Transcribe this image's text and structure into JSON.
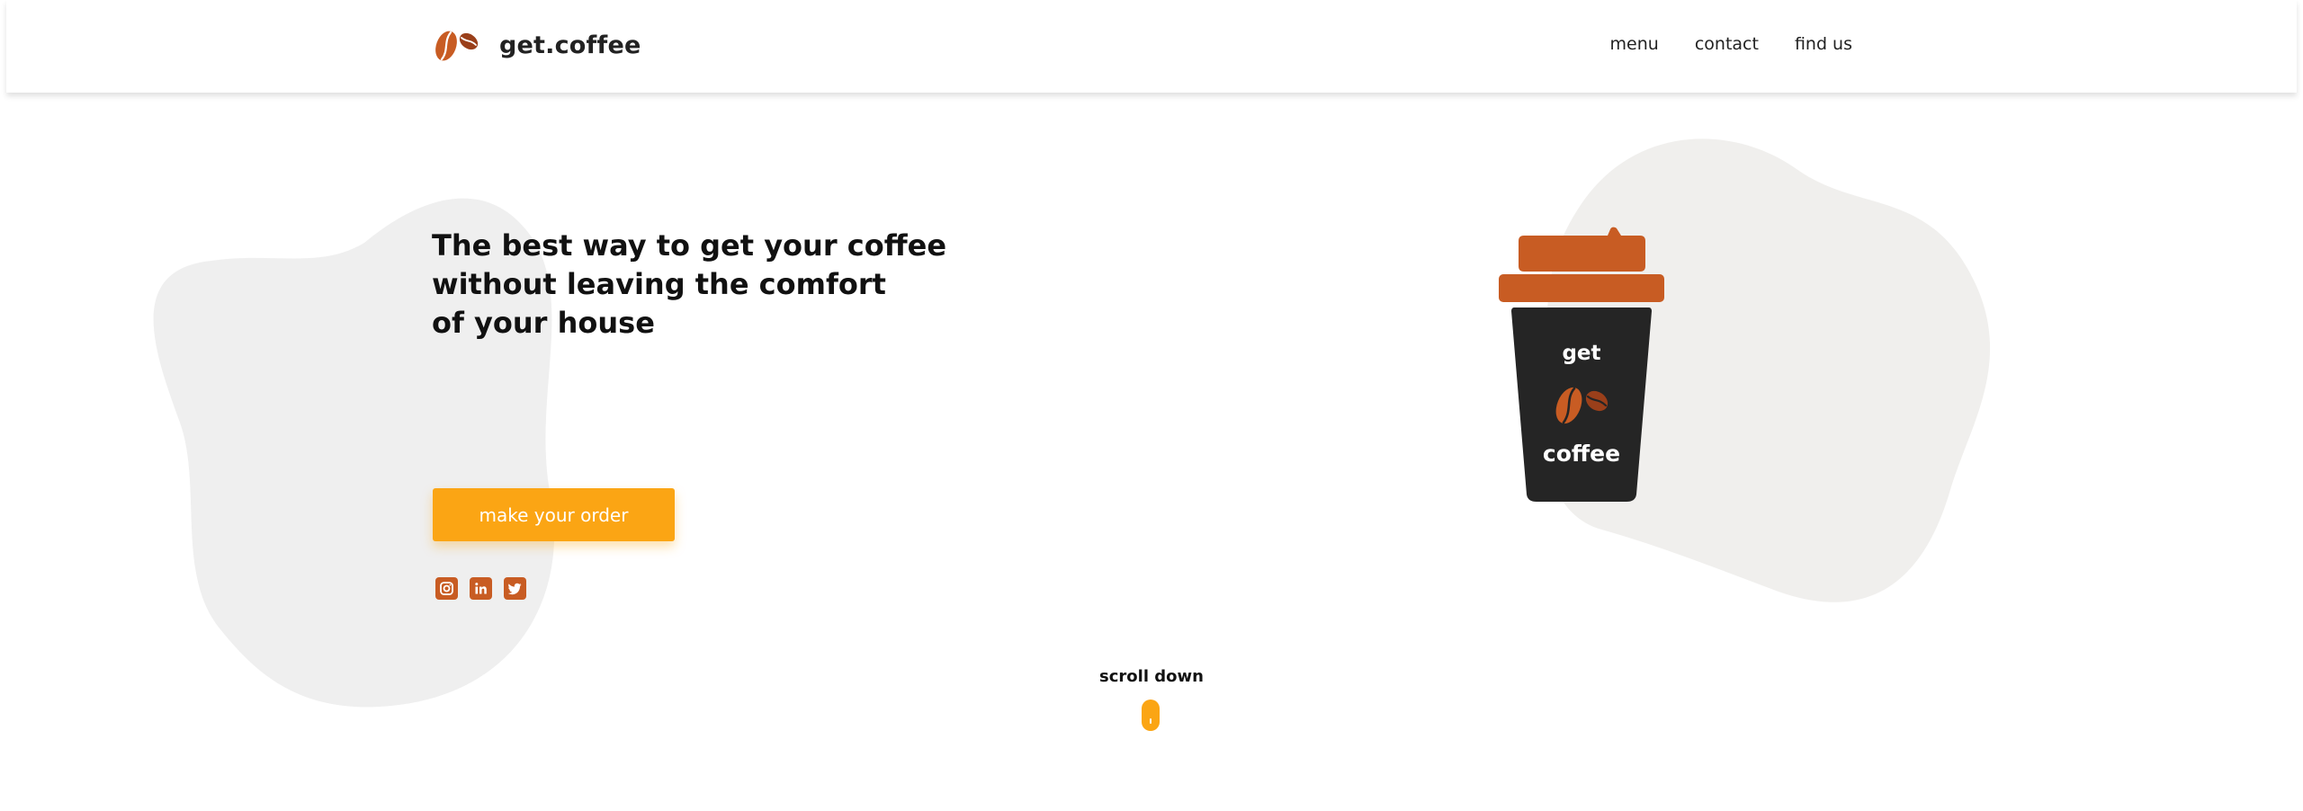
{
  "header": {
    "logo_text": "get.coffee",
    "logo_icon": "coffee-beans-icon",
    "nav": [
      {
        "label": "menu"
      },
      {
        "label": "contact"
      },
      {
        "label": "find us"
      }
    ]
  },
  "hero": {
    "headline_lines": [
      "The best way to get your coffee",
      "without leaving the comfort",
      "of your house"
    ],
    "cta_label": "make your order",
    "socials": [
      {
        "icon": "instagram-icon"
      },
      {
        "icon": "linkedin-icon"
      },
      {
        "icon": "twitter-icon"
      }
    ]
  },
  "cup": {
    "text_top": "get",
    "text_bottom": "coffee"
  },
  "scroll": {
    "label": "scroll down"
  },
  "colors": {
    "brand": "#c85c23",
    "accent": "#fba514",
    "cup_body": "#252525",
    "blob": "#efeeec"
  }
}
